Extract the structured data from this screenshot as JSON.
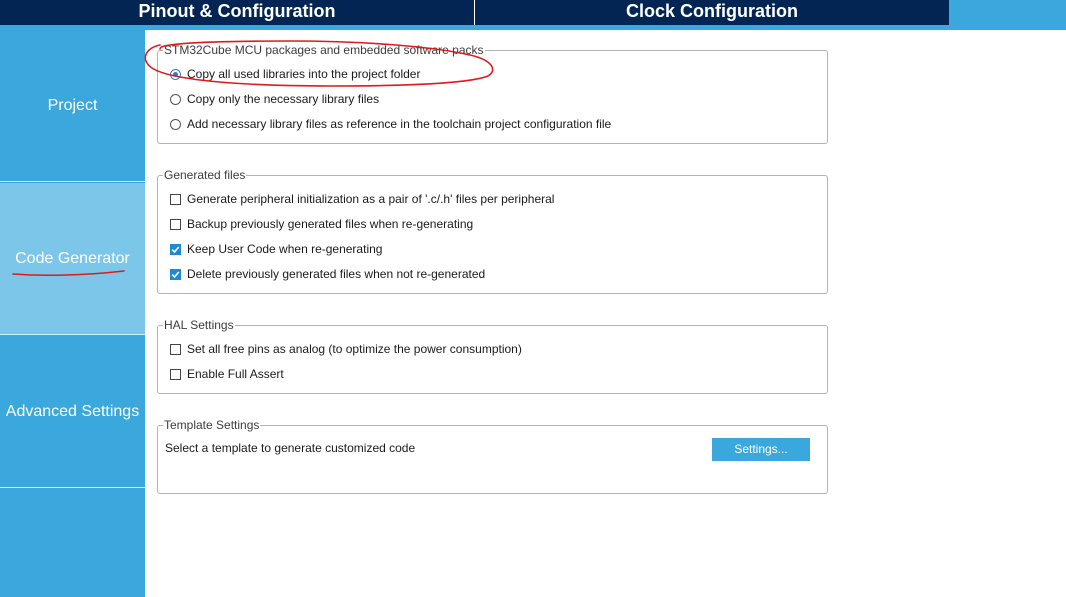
{
  "tabs": [
    {
      "label": "Pinout & Configuration"
    },
    {
      "label": "Clock Configuration"
    }
  ],
  "sidebar": {
    "items": [
      {
        "label": "Project"
      },
      {
        "label": "Code Generator"
      },
      {
        "label": "Advanced Settings"
      }
    ]
  },
  "packages": {
    "title": "STM32Cube MCU packages and embedded software packs",
    "options": [
      {
        "label": "Copy all used libraries into the project folder",
        "selected": true
      },
      {
        "label": "Copy only the necessary library files",
        "selected": false
      },
      {
        "label": "Add necessary library files as reference in the toolchain project configuration file",
        "selected": false
      }
    ]
  },
  "generated_files": {
    "title": "Generated files",
    "options": [
      {
        "label": "Generate peripheral initialization as a pair of '.c/.h' files per peripheral",
        "checked": false
      },
      {
        "label": "Backup previously generated files when re-generating",
        "checked": false
      },
      {
        "label": "Keep User Code when re-generating",
        "checked": true
      },
      {
        "label": "Delete previously generated files when not re-generated",
        "checked": true
      }
    ]
  },
  "hal_settings": {
    "title": "HAL Settings",
    "options": [
      {
        "label": "Set all free pins as analog (to optimize the power consumption)",
        "checked": false
      },
      {
        "label": "Enable Full Assert",
        "checked": false
      }
    ]
  },
  "template_settings": {
    "title": "Template Settings",
    "description": "Select a template to generate customized code",
    "button_label": "Settings..."
  },
  "colors": {
    "header_dark": "#022553",
    "accent_blue": "#3aa8dd",
    "sidebar_active": "#7cc6ea",
    "annotation_red": "#e0191e"
  }
}
